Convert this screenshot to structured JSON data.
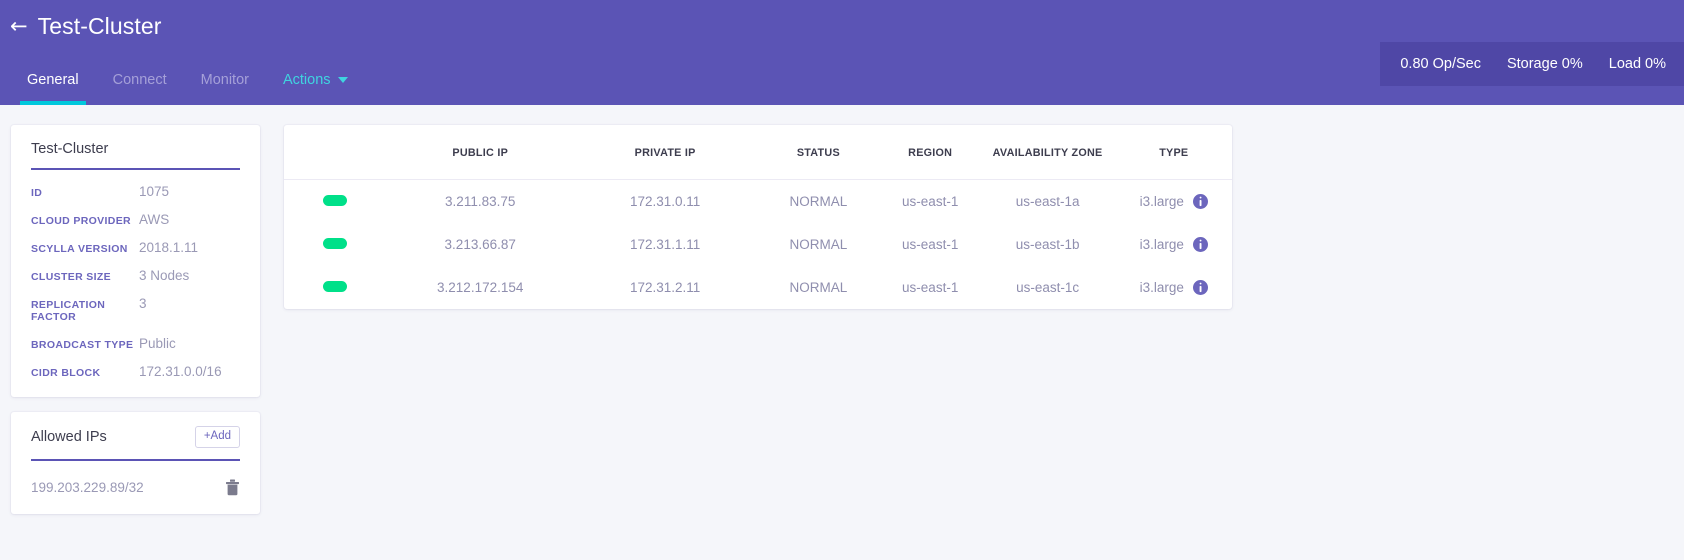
{
  "header": {
    "back_icon": "arrow-left-icon",
    "title": "Test-Cluster",
    "tabs": [
      {
        "label": "General",
        "active": true
      },
      {
        "label": "Connect",
        "active": false
      },
      {
        "label": "Monitor",
        "active": false
      }
    ],
    "actions_label": "Actions",
    "actions_caret_icon": "chevron-down-icon",
    "stats": [
      {
        "label": "0.80 Op/Sec"
      },
      {
        "label": "Storage 0%"
      },
      {
        "label": "Load 0%"
      }
    ],
    "colors": {
      "background": "#5b54b5",
      "stats_background": "#4f47a6",
      "active_tab_underline": "#00c8dc",
      "actions_text": "#3fd4e0"
    }
  },
  "info_card": {
    "heading": "Test-Cluster",
    "rows": [
      {
        "label": "ID",
        "value": "1075"
      },
      {
        "label": "CLOUD PROVIDER",
        "value": "AWS"
      },
      {
        "label": "SCYLLA VERSION",
        "value": "2018.1.11"
      },
      {
        "label": "CLUSTER SIZE",
        "value": "3 Nodes"
      },
      {
        "label": "REPLICATION FACTOR",
        "value": "3"
      },
      {
        "label": "BROADCAST TYPE",
        "value": "Public"
      },
      {
        "label": "CIDR BLOCK",
        "value": "172.31.0.0/16"
      }
    ]
  },
  "allowed_ips_card": {
    "heading": "Allowed IPs",
    "add_label": "+Add",
    "delete_icon": "trash-icon",
    "items": [
      {
        "value": "199.203.229.89/32"
      }
    ]
  },
  "nodes_table": {
    "columns": [
      "",
      "PUBLIC IP",
      "PRIVATE IP",
      "STATUS",
      "REGION",
      "AVAILABILITY ZONE",
      "TYPE"
    ],
    "status_color": "#00e089",
    "info_icon": "info-icon",
    "rows": [
      {
        "status_indicator": "online",
        "public_ip": "3.211.83.75",
        "private_ip": "172.31.0.11",
        "status": "NORMAL",
        "region": "us-east-1",
        "availability_zone": "us-east-1a",
        "type": "i3.large"
      },
      {
        "status_indicator": "online",
        "public_ip": "3.213.66.87",
        "private_ip": "172.31.1.11",
        "status": "NORMAL",
        "region": "us-east-1",
        "availability_zone": "us-east-1b",
        "type": "i3.large"
      },
      {
        "status_indicator": "online",
        "public_ip": "3.212.172.154",
        "private_ip": "172.31.2.11",
        "status": "NORMAL",
        "region": "us-east-1",
        "availability_zone": "us-east-1c",
        "type": "i3.large"
      }
    ]
  }
}
